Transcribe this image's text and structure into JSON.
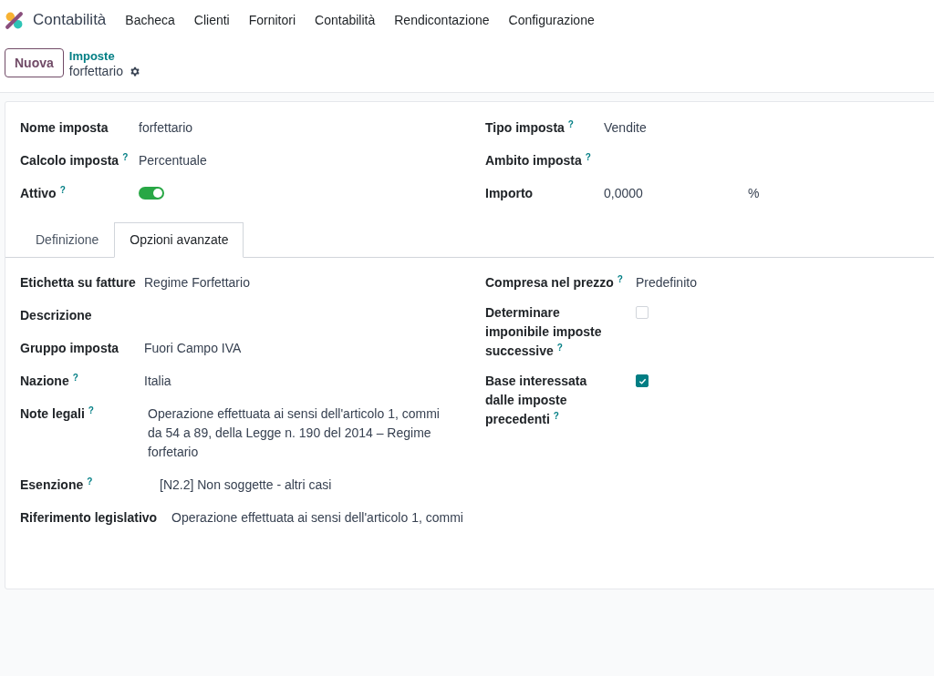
{
  "app": {
    "name": "Contabilità"
  },
  "menu": [
    {
      "label": "Bacheca"
    },
    {
      "label": "Clienti"
    },
    {
      "label": "Fornitori"
    },
    {
      "label": "Contabilità"
    },
    {
      "label": "Rendicontazione"
    },
    {
      "label": "Configurazione"
    }
  ],
  "control_panel": {
    "new_button": "Nuova",
    "breadcrumb": "Imposte",
    "record": "forfettario"
  },
  "header_left": [
    {
      "kind": "text",
      "label": "Nome imposta",
      "value": "forfettario"
    },
    {
      "kind": "text",
      "label": "Calcolo imposta",
      "help": "?",
      "value": "Percentuale"
    },
    {
      "kind": "toggle",
      "label": "Attivo",
      "help": "?",
      "on": true
    }
  ],
  "header_right": [
    {
      "kind": "text",
      "label": "Tipo imposta",
      "help": "?",
      "value": "Vendite"
    },
    {
      "kind": "text",
      "label": "Ambito imposta",
      "help": "?"
    },
    {
      "kind": "amount",
      "label": "Importo",
      "value": "0,0000",
      "unit": "%"
    }
  ],
  "tabs": [
    {
      "label": "Definizione",
      "selected": false
    },
    {
      "label": "Opzioni avanzate",
      "selected": true
    }
  ],
  "tab_left": [
    {
      "kind": "text",
      "label": "Etichetta su fatture",
      "value": "Regime Forfettario"
    },
    {
      "kind": "text",
      "label": "Descrizione"
    },
    {
      "kind": "text",
      "label": "Gruppo imposta",
      "value": "Fuori Campo IVA"
    },
    {
      "kind": "text",
      "label": "Nazione",
      "help": "?",
      "value": "Italia"
    },
    {
      "kind": "text",
      "label": "Note legali",
      "help": "?",
      "value": "Operazione effettuata ai sensi dell'articolo 1, commi da 54 a 89, della Legge n. 190 del 2014 – Regime forfetario"
    },
    {
      "kind": "text",
      "label": "Esenzione",
      "help": "?",
      "value": "[N2.2] Non soggette - altri casi"
    },
    {
      "kind": "text",
      "label": "Riferimento legislativo",
      "value": "Operazione effettuata ai sensi dell'articolo 1, commi"
    }
  ],
  "tab_right": [
    {
      "kind": "text",
      "label": "Compresa nel prezzo",
      "help": "?",
      "value": "Predefinito"
    },
    {
      "kind": "checkbox",
      "label": "Determinare imponibile imposte successive",
      "help": "?",
      "checked": false
    },
    {
      "kind": "checkbox",
      "label": "Base interessata dalle imposte precedenti",
      "help": "?",
      "checked": true
    }
  ]
}
